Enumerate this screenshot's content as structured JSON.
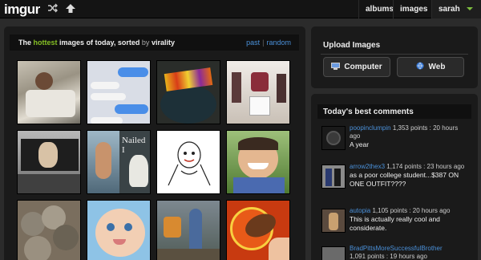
{
  "topbar": {
    "logo": "imgur",
    "shuffle_icon": "shuffle-icon",
    "upload_icon": "upload-arrow-icon",
    "nav": [
      "albums",
      "images"
    ],
    "user": "sarah"
  },
  "gallery": {
    "headline_pre": "The",
    "headline_hot": "hottest",
    "headline_post": "images of today, sorted",
    "headline_by": "by",
    "headline_sort": "virality",
    "links": [
      "past",
      "random"
    ],
    "thumb_caption": "Nailed I"
  },
  "upload": {
    "title": "Upload Images",
    "computer_label": "Computer",
    "web_label": "Web"
  },
  "comments": {
    "title": "Today's best comments",
    "items": [
      {
        "user": "poopinclumpin",
        "meta": "1,353 points : 20 hours ago",
        "text": "A year"
      },
      {
        "user": "arrow2thex3",
        "meta": "1,174 points : 23 hours ago",
        "text": "as a poor college student...$387 ON ONE OUTFIT????"
      },
      {
        "user": "autopia",
        "meta": "1,105 points : 20 hours ago",
        "text": "This is actually really cool and considerate."
      },
      {
        "user": "BradPittsMoreSuccessfulBrother",
        "meta": "1,091 points : 19 hours ago",
        "text": ""
      }
    ]
  },
  "colors": {
    "accent_green": "#85bf25",
    "link_blue": "#4a90d9",
    "panel": "#1a1a1a",
    "background": "#2b2b2b"
  }
}
